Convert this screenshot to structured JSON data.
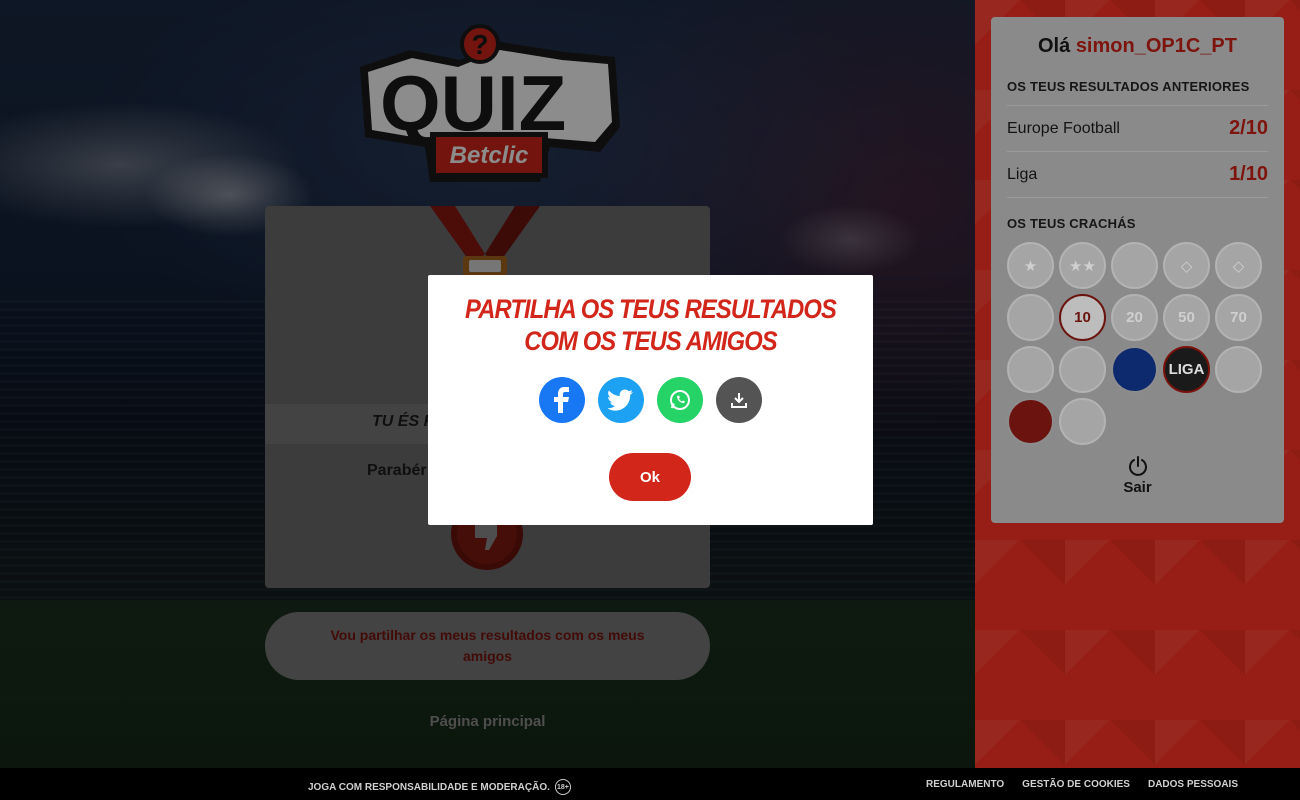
{
  "logo": {
    "quiz_text": "QUIZ",
    "brand_text": "Betclic"
  },
  "result_card": {
    "title": "TU ÉS F",
    "message": "Parabér"
  },
  "share_results_button": "Vou partilhar os meus resultados com os meus amigos",
  "home_link": "Página principal",
  "sidebar": {
    "greeting": "Olá",
    "username": "simon_OP1C_PT",
    "previous_results_title": "OS TEUS RESULTADOS ANTERIORES",
    "results": [
      {
        "name": "Europe Football",
        "score": "2/10"
      },
      {
        "name": "Liga",
        "score": "1/10"
      }
    ],
    "badges_title": "OS TEUS CRACHÁS",
    "badges": [
      {
        "icon": "one-star-badge",
        "label": "★",
        "state": "locked"
      },
      {
        "icon": "two-star-badge",
        "label": "★★",
        "state": "locked"
      },
      {
        "icon": "goat-badge",
        "label": "",
        "state": "locked"
      },
      {
        "icon": "diamond-badge",
        "label": "◇",
        "state": "locked"
      },
      {
        "icon": "diamond-badge-2",
        "label": "◇",
        "state": "locked"
      },
      {
        "icon": "player-badge",
        "label": "",
        "state": "locked"
      },
      {
        "icon": "ten-badge",
        "label": "10",
        "state": "earned-white"
      },
      {
        "icon": "twenty-badge",
        "label": "20",
        "state": "locked"
      },
      {
        "icon": "fifty-badge",
        "label": "50",
        "state": "locked"
      },
      {
        "icon": "seventy-badge",
        "label": "70",
        "state": "locked"
      },
      {
        "icon": "europe-map-badge",
        "label": "",
        "state": "locked"
      },
      {
        "icon": "microphone-badge",
        "label": "",
        "state": "locked"
      },
      {
        "icon": "europe-map-blue-badge",
        "label": "",
        "state": "earned-blue"
      },
      {
        "icon": "liga-badge",
        "label": "LIGA",
        "state": "earned-black"
      },
      {
        "icon": "finger-badge",
        "label": "",
        "state": "locked"
      },
      {
        "icon": "thumbs-down-badge",
        "label": "",
        "state": "earned"
      },
      {
        "icon": "muscle-badge",
        "label": "",
        "state": "locked"
      }
    ],
    "logout_label": "Sair"
  },
  "modal": {
    "heading": "PARTILHA OS TEUS RESULTADOS COM OS TEUS AMIGOS",
    "share_buttons": [
      {
        "icon": "facebook-icon",
        "color": "#1877f2"
      },
      {
        "icon": "twitter-icon",
        "color": "#1da1f2"
      },
      {
        "icon": "whatsapp-icon",
        "color": "#25d366"
      },
      {
        "icon": "download-icon",
        "color": "#545454"
      }
    ],
    "ok_label": "Ok"
  },
  "footer": {
    "responsibility": "JOGA COM RESPONSABILIDADE E MODERAÇÃO.",
    "age_badge": "18+",
    "links": [
      "REGULAMENTO",
      "GESTÃO DE COOKIES",
      "DADOS PESSOAIS"
    ]
  },
  "colors": {
    "accent_red": "#d3261b",
    "panel_red": "#c8281e",
    "dark_red": "#7d140e"
  }
}
